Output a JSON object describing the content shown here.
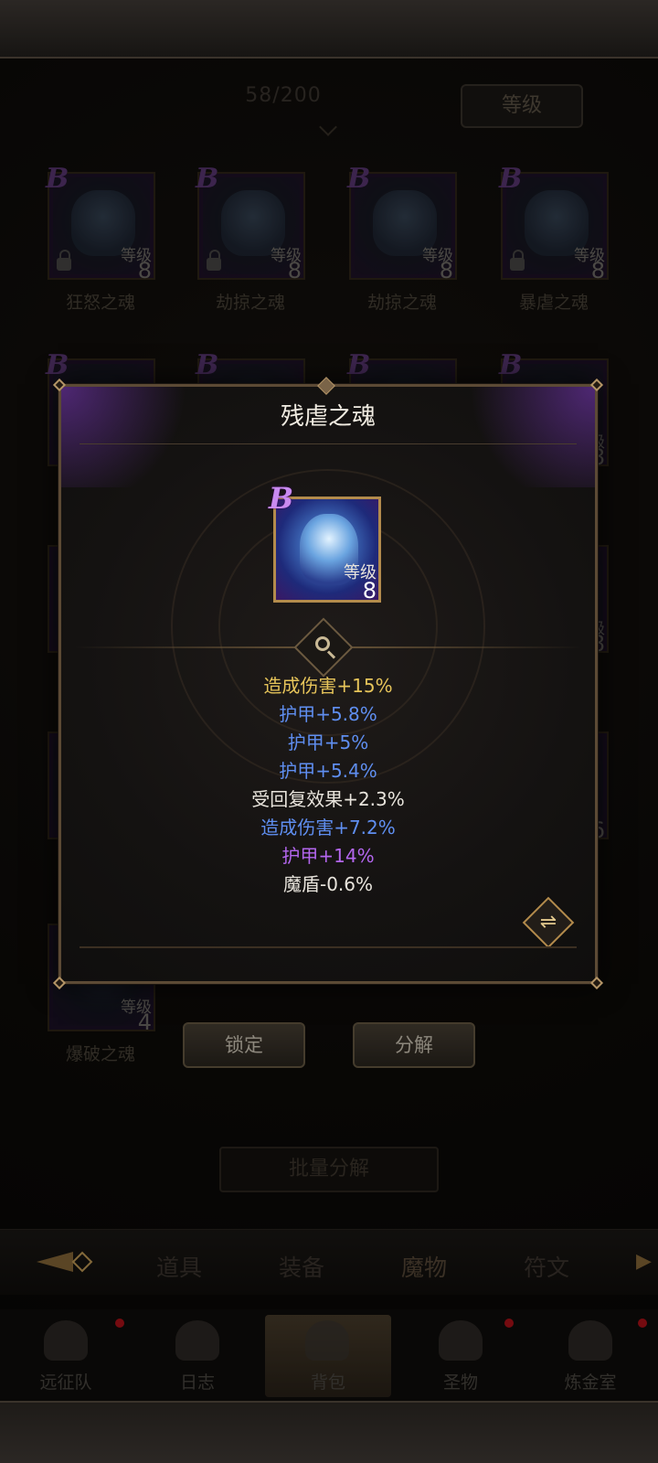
{
  "header": {
    "counter": "58/200",
    "sort_label": "等级"
  },
  "grid": {
    "row1": [
      {
        "name": "狂怒之魂",
        "grade": "B",
        "level_label": "等级",
        "level": "8",
        "locked": true
      },
      {
        "name": "劫掠之魂",
        "grade": "B",
        "level_label": "等级",
        "level": "8",
        "locked": true
      },
      {
        "name": "劫掠之魂",
        "grade": "B",
        "level_label": "等级",
        "level": "8",
        "locked": false
      },
      {
        "name": "暴虐之魂",
        "grade": "B",
        "level_label": "等级",
        "level": "8",
        "locked": true
      }
    ],
    "row2_grades": [
      "B",
      "B",
      "B",
      "B"
    ],
    "row2_right_level_label": "级",
    "row2_right_level": "8",
    "row3_right_level_label": "级",
    "row3_right_level": "8",
    "row4_right_level": "6",
    "last": {
      "name": "爆破之魂",
      "level_label": "等级",
      "level": "4"
    }
  },
  "popup": {
    "title": "残虐之魂",
    "card": {
      "grade": "B",
      "level_label": "等级",
      "level": "8"
    },
    "stats": [
      {
        "text": "造成伤害+15%",
        "color": "#e6c45a"
      },
      {
        "text": "护甲+5.8%",
        "color": "#5f8ef0"
      },
      {
        "text": "护甲+5%",
        "color": "#5f8ef0"
      },
      {
        "text": "护甲+5.4%",
        "color": "#5f8ef0"
      },
      {
        "text": "受回复效果+2.3%",
        "color": "#e8e4dc"
      },
      {
        "text": "造成伤害+7.2%",
        "color": "#5f8ef0"
      },
      {
        "text": "护甲+14%",
        "color": "#b366ee"
      },
      {
        "text": "魔盾-0.6%",
        "color": "#e8e4dc"
      }
    ],
    "swap_icon": "swap-icon",
    "magnify_icon": "magnify-icon"
  },
  "actions": {
    "lock_label": "锁定",
    "decompose_label": "分解",
    "batch_label": "批量分解"
  },
  "tabs": {
    "items": [
      "道具",
      "装备",
      "魔物",
      "符文"
    ],
    "active": "魔物"
  },
  "nav": {
    "items": [
      {
        "label": "远征队",
        "icon": "helmet-icon"
      },
      {
        "label": "日志",
        "icon": "scroll-icon"
      },
      {
        "label": "背包",
        "icon": "chest-icon"
      },
      {
        "label": "圣物",
        "icon": "torch-icon"
      },
      {
        "label": "炼金室",
        "icon": "alchemy-icon"
      }
    ],
    "active": "背包"
  }
}
